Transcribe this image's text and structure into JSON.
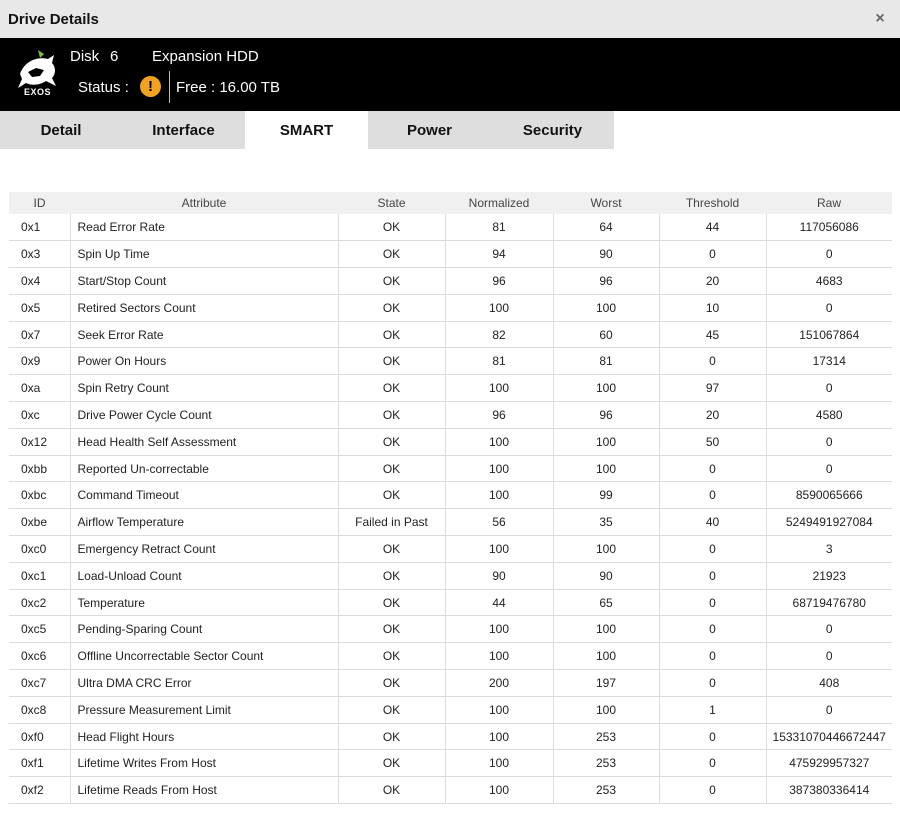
{
  "window": {
    "title": "Drive Details",
    "close_symbol": "×"
  },
  "header": {
    "logo_text": "EXOS",
    "disk_label": "Disk",
    "disk_number": "6",
    "model": "Expansion HDD",
    "status_label": "Status :",
    "status_symbol": "!",
    "free_label": "Free : 16.00 TB",
    "status_color": "#f2a21f"
  },
  "tabs": [
    {
      "label": "Detail",
      "active": false
    },
    {
      "label": "Interface",
      "active": false
    },
    {
      "label": "SMART",
      "active": true
    },
    {
      "label": "Power",
      "active": false
    },
    {
      "label": "Security",
      "active": false
    }
  ],
  "table": {
    "headers": [
      "ID",
      "Attribute",
      "State",
      "Normalized",
      "Worst",
      "Threshold",
      "Raw"
    ],
    "rows": [
      [
        "0x1",
        "Read Error Rate",
        "OK",
        "81",
        "64",
        "44",
        "117056086"
      ],
      [
        "0x3",
        "Spin Up Time",
        "OK",
        "94",
        "90",
        "0",
        "0"
      ],
      [
        "0x4",
        "Start/Stop Count",
        "OK",
        "96",
        "96",
        "20",
        "4683"
      ],
      [
        "0x5",
        "Retired Sectors Count",
        "OK",
        "100",
        "100",
        "10",
        "0"
      ],
      [
        "0x7",
        "Seek Error Rate",
        "OK",
        "82",
        "60",
        "45",
        "151067864"
      ],
      [
        "0x9",
        "Power On Hours",
        "OK",
        "81",
        "81",
        "0",
        "17314"
      ],
      [
        "0xa",
        "Spin Retry Count",
        "OK",
        "100",
        "100",
        "97",
        "0"
      ],
      [
        "0xc",
        "Drive Power Cycle Count",
        "OK",
        "96",
        "96",
        "20",
        "4580"
      ],
      [
        "0x12",
        "Head Health Self Assessment",
        "OK",
        "100",
        "100",
        "50",
        "0"
      ],
      [
        "0xbb",
        "Reported Un-correctable",
        "OK",
        "100",
        "100",
        "0",
        "0"
      ],
      [
        "0xbc",
        "Command Timeout",
        "OK",
        "100",
        "99",
        "0",
        "8590065666"
      ],
      [
        "0xbe",
        "Airflow Temperature",
        "Failed in Past",
        "56",
        "35",
        "40",
        "5249491927084"
      ],
      [
        "0xc0",
        "Emergency Retract Count",
        "OK",
        "100",
        "100",
        "0",
        "3"
      ],
      [
        "0xc1",
        "Load-Unload Count",
        "OK",
        "90",
        "90",
        "0",
        "21923"
      ],
      [
        "0xc2",
        "Temperature",
        "OK",
        "44",
        "65",
        "0",
        "68719476780"
      ],
      [
        "0xc5",
        "Pending-Sparing Count",
        "OK",
        "100",
        "100",
        "0",
        "0"
      ],
      [
        "0xc6",
        "Offline Uncorrectable Sector Count",
        "OK",
        "100",
        "100",
        "0",
        "0"
      ],
      [
        "0xc7",
        "Ultra DMA CRC Error",
        "OK",
        "200",
        "197",
        "0",
        "408"
      ],
      [
        "0xc8",
        "Pressure Measurement Limit",
        "OK",
        "100",
        "100",
        "1",
        "0"
      ],
      [
        "0xf0",
        "Head Flight Hours",
        "OK",
        "100",
        "253",
        "0",
        "15331070446672447"
      ],
      [
        "0xf1",
        "Lifetime Writes From Host",
        "OK",
        "100",
        "253",
        "0",
        "475929957327"
      ],
      [
        "0xf2",
        "Lifetime Reads From Host",
        "OK",
        "100",
        "253",
        "0",
        "387380336414"
      ]
    ]
  }
}
